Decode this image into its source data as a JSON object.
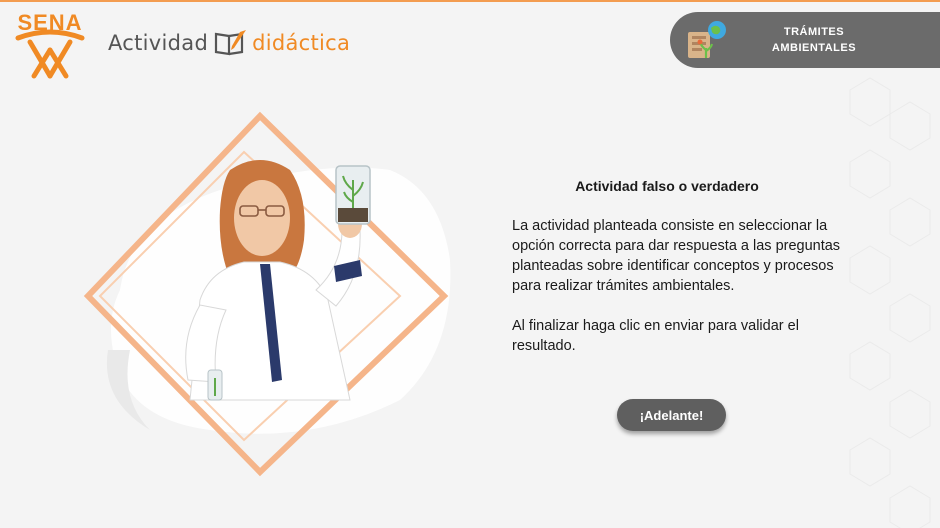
{
  "header": {
    "logo_text": "SENA",
    "brand_word1": "Actividad",
    "brand_word2": "didáctica",
    "badge_line1": "TRÁMITES",
    "badge_line2": "AMBIENTALES"
  },
  "activity": {
    "title": "Actividad falso o verdadero",
    "paragraph1": "La actividad planteada consiste en seleccionar la opción correcta para dar respuesta a las preguntas planteadas sobre identificar conceptos y procesos para realizar trámites ambientales.",
    "paragraph2": "Al finalizar haga clic en enviar para validar el resultado.",
    "start_button": "¡Adelante!"
  },
  "colors": {
    "accent": "#f08a24",
    "badge_bg": "#6b6b6b",
    "button_bg": "#5f5f5f",
    "background": "#f4f4f4"
  },
  "icons": [
    "sena-logo-icon",
    "book-pencil-icon",
    "environmental-procedures-icon"
  ]
}
